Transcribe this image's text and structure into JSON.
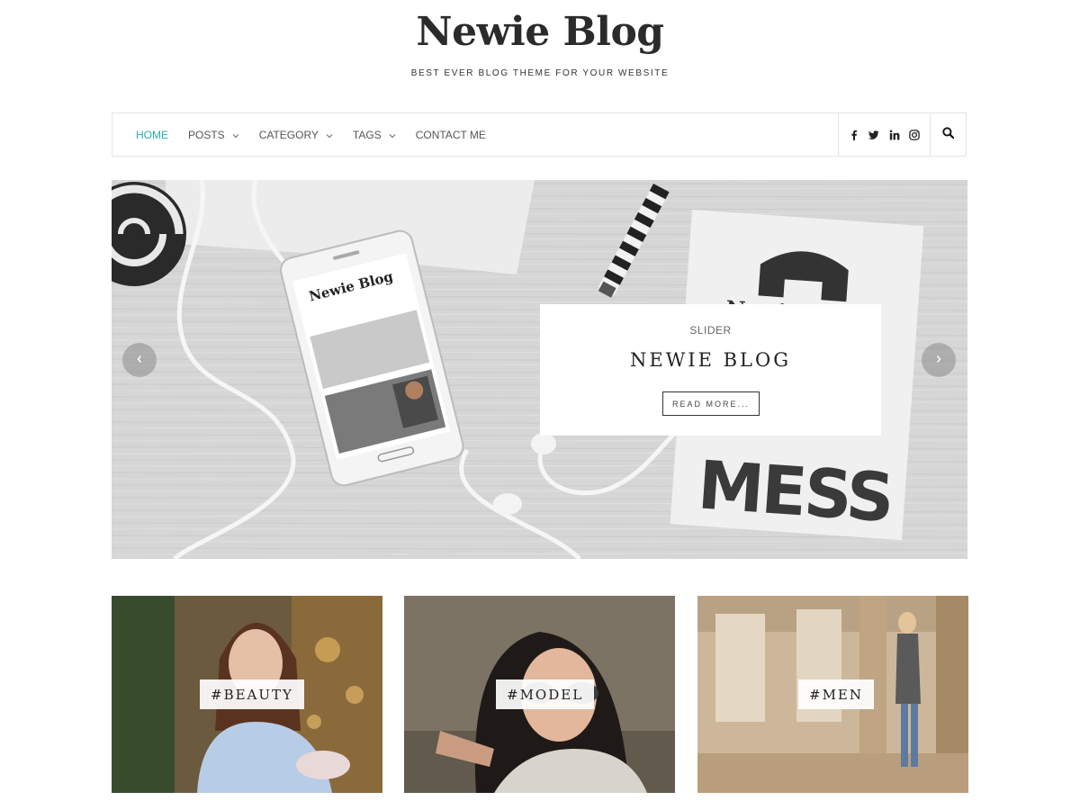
{
  "header": {
    "site_title": "Newie Blog",
    "tagline": "BEST EVER BLOG THEME FOR YOUR WEBSITE"
  },
  "nav": {
    "items": [
      {
        "label": "HOME",
        "active": true,
        "has_dropdown": false
      },
      {
        "label": "POSTS",
        "active": false,
        "has_dropdown": true
      },
      {
        "label": "CATEGORY",
        "active": false,
        "has_dropdown": true
      },
      {
        "label": "TAGS",
        "active": false,
        "has_dropdown": true
      },
      {
        "label": "CONTACT ME",
        "active": false,
        "has_dropdown": false
      }
    ],
    "social_icons": [
      "facebook-icon",
      "twitter-icon",
      "linkedin-icon",
      "instagram-icon"
    ],
    "search_icon": "search-icon",
    "active_color": "#20b2aa"
  },
  "slider": {
    "category": "SLIDER",
    "title": "NEWIE BLOG",
    "button_label": "READ MORE...",
    "prev_icon": "chevron-left-icon",
    "next_icon": "chevron-right-icon",
    "image_text": {
      "phone_title": "Newie Blog",
      "magazine_title": "Newie Blo",
      "magazine_big": "MESS"
    }
  },
  "tiles": [
    {
      "label": "#BEAUTY"
    },
    {
      "label": "#MODEL"
    },
    {
      "label": "#MEN"
    }
  ]
}
